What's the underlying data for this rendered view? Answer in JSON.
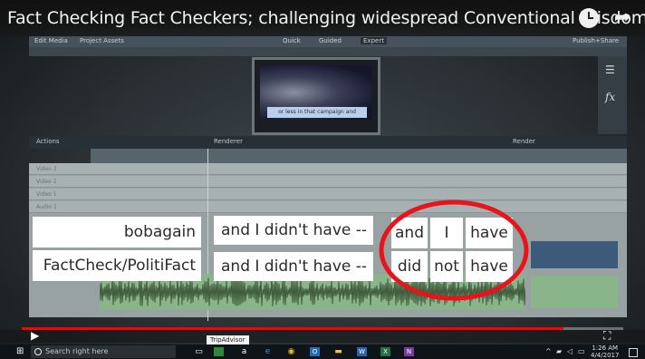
{
  "video": {
    "title": "Fact Checking Fact Checkers; challenging widespread Conventional Wisdom...",
    "progress_fraction": 0.9
  },
  "editor": {
    "menu": [
      "Edit Media",
      "Project Assets",
      "Quick",
      "Guided",
      "Expert",
      "Publish+Share"
    ],
    "preview_caption": "or less in that campaign and",
    "timeline_labels": [
      "Actions",
      "Renderer",
      "Render"
    ],
    "tracks": [
      "Video 3",
      "Video 2",
      "Video 1",
      "Audio 1"
    ]
  },
  "overlay": {
    "speakers": [
      "bobagain",
      "FactCheck/PolitiFact"
    ],
    "quote_top": "and I didn't have --",
    "quote_bottom": "and I didn't have --",
    "words_top": [
      "and",
      "I",
      "have"
    ],
    "words_bottom": [
      "did",
      "not",
      "have"
    ],
    "highlight_color": "#e8141c"
  },
  "player": {
    "tooltip": "TripAdvisor"
  },
  "taskbar": {
    "search_placeholder": "Search right here",
    "time": "1:26 AM",
    "date": "4/4/2017",
    "apps": [
      "task-view",
      "store",
      "amazon",
      "edge",
      "chrome",
      "outlook",
      "files",
      "word",
      "excel",
      "onenote"
    ]
  }
}
